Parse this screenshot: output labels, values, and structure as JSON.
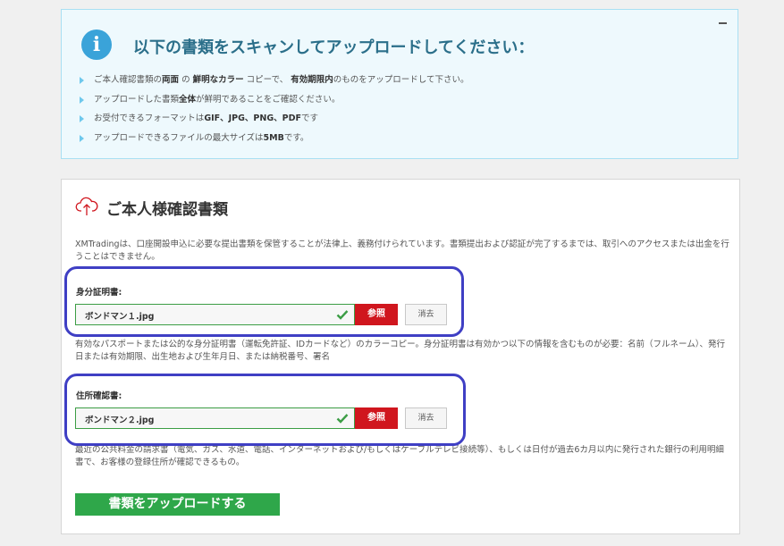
{
  "info": {
    "title": "以下の書類をスキャンしてアップロードしてください：",
    "items": [
      {
        "p1": "ご本人確認書類の",
        "b1": "両面",
        "p2": "の",
        "b2": "鮮明なカラー",
        "p3": "コピーで、",
        "b3": "有効期限内",
        "p4": "のものをアップロードして下さい。"
      },
      {
        "p1": "アップロードした書類",
        "b1": "全体",
        "p2": "が鮮明であることをご確認ください。"
      },
      {
        "p1": "お受付できるフォーマットは",
        "b1": "GIF、JPG、PNG、PDF",
        "p2": "です"
      },
      {
        "p1": "アップロードできるファイルの最大サイズは",
        "b1": "5MB",
        "p2": "です。"
      }
    ]
  },
  "panel": {
    "title": "ご本人様確認書類",
    "description": "XMTradingは、口座開設申込に必要な提出書類を保管することが法律上、義務付けられています。書類提出および認証が完了するまでは、取引へのアクセスまたは出金を行うことはできません。",
    "id_doc": {
      "label": "身分証明書:",
      "file_name": "ボンドマン１.jpg",
      "browse_label": "参照",
      "clear_label": "消去",
      "help": "有効なパスポートまたは公的な身分証明書（運転免許証、IDカードなど）のカラーコピー。身分証明書は有効かつ以下の情報を含むものが必要：名前（フルネーム）、発行日または有効期限、出生地および生年月日、または納税番号、署名"
    },
    "address_doc": {
      "label": "住所確認書:",
      "file_name": "ボンドマン２.jpg",
      "browse_label": "参照",
      "clear_label": "消去",
      "help": "最近の公共料金の請求書（電気、ガス、水道、電話、インターネットおよび/もしくはケーブルテレビ接続等）、もしくは日付が過去6カ月以内に発行された銀行の利用明細書で、お客様の登録住所が確認できるもの。"
    },
    "upload_label": "書類をアップロードする"
  },
  "colors": {
    "accent_red": "#d0161e",
    "accent_green": "#2fa74a",
    "info_blue": "#3aa3d9",
    "highlight": "#3f3fc4"
  }
}
